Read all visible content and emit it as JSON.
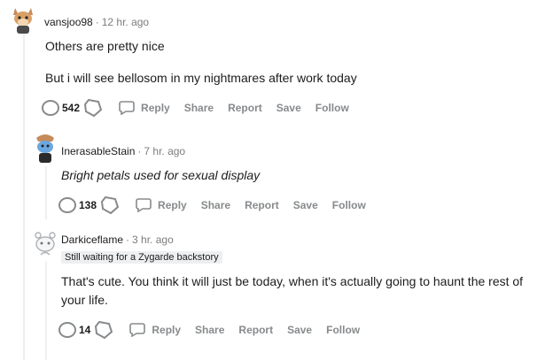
{
  "comments": [
    {
      "username": "vansjoo98",
      "time": "12 hr. ago",
      "separator": "·",
      "paragraphs": [
        "Others are pretty nice",
        "But i will see bellosom in my nightmares after work today"
      ],
      "score": "542",
      "actions": {
        "reply": "Reply",
        "share": "Share",
        "report": "Report",
        "save": "Save",
        "follow": "Follow"
      }
    },
    {
      "username": "InerasableStain",
      "time": "7 hr. ago",
      "separator": "·",
      "paragraphs": [
        "Bright petals used for sexual display"
      ],
      "score": "138",
      "actions": {
        "reply": "Reply",
        "share": "Share",
        "report": "Report",
        "save": "Save",
        "follow": "Follow"
      }
    },
    {
      "username": "Darkiceflame",
      "time": "3 hr. ago",
      "separator": "·",
      "flair": "Still waiting for a Zygarde backstory",
      "paragraphs": [
        "That's cute. You think it will just be today, when it's actually going to haunt the rest of your life."
      ],
      "score": "14",
      "actions": {
        "reply": "Reply",
        "share": "Share",
        "report": "Report",
        "save": "Save",
        "follow": "Follow"
      }
    }
  ],
  "icons": {
    "upvote": "upvote-icon",
    "downvote": "downvote-icon",
    "reply": "reply-icon",
    "avatar": "avatar-icon"
  },
  "colors": {
    "action_gray": "#878a8c",
    "meta_gray": "#7c7c7c",
    "text": "#1c1c1c",
    "thread_line": "#edeff1"
  }
}
